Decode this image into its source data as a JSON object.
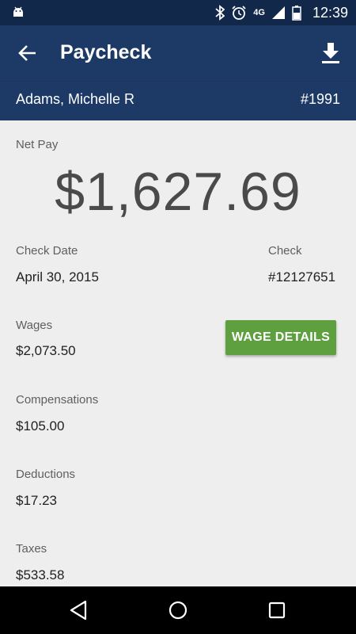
{
  "status_bar": {
    "time": "12:39",
    "network": "4G",
    "icons": [
      "android-icon",
      "bluetooth-icon",
      "alarm-icon",
      "signal-icon",
      "battery-icon"
    ]
  },
  "app_bar": {
    "title": "Paycheck",
    "back_icon": "arrow-left-icon",
    "download_icon": "download-icon"
  },
  "employee": {
    "name": "Adams, Michelle R",
    "id": "#1991"
  },
  "paycheck": {
    "net_pay_label": "Net Pay",
    "net_pay": "$1,627.69",
    "check_date_label": "Check Date",
    "check_date": "April 30, 2015",
    "check_label": "Check",
    "check_number": "#12127651",
    "wages_label": "Wages",
    "wages": "$2,073.50",
    "wage_details_button": "WAGE DETAILS",
    "compensations_label": "Compensations",
    "compensations": "$105.00",
    "deductions_label": "Deductions",
    "deductions": "$17.23",
    "taxes_label": "Taxes",
    "taxes": "$533.58"
  },
  "colors": {
    "app_bar": "#1d3a66",
    "status_bar": "#12284a",
    "button": "#5e9f40",
    "background": "#eeeeee"
  }
}
